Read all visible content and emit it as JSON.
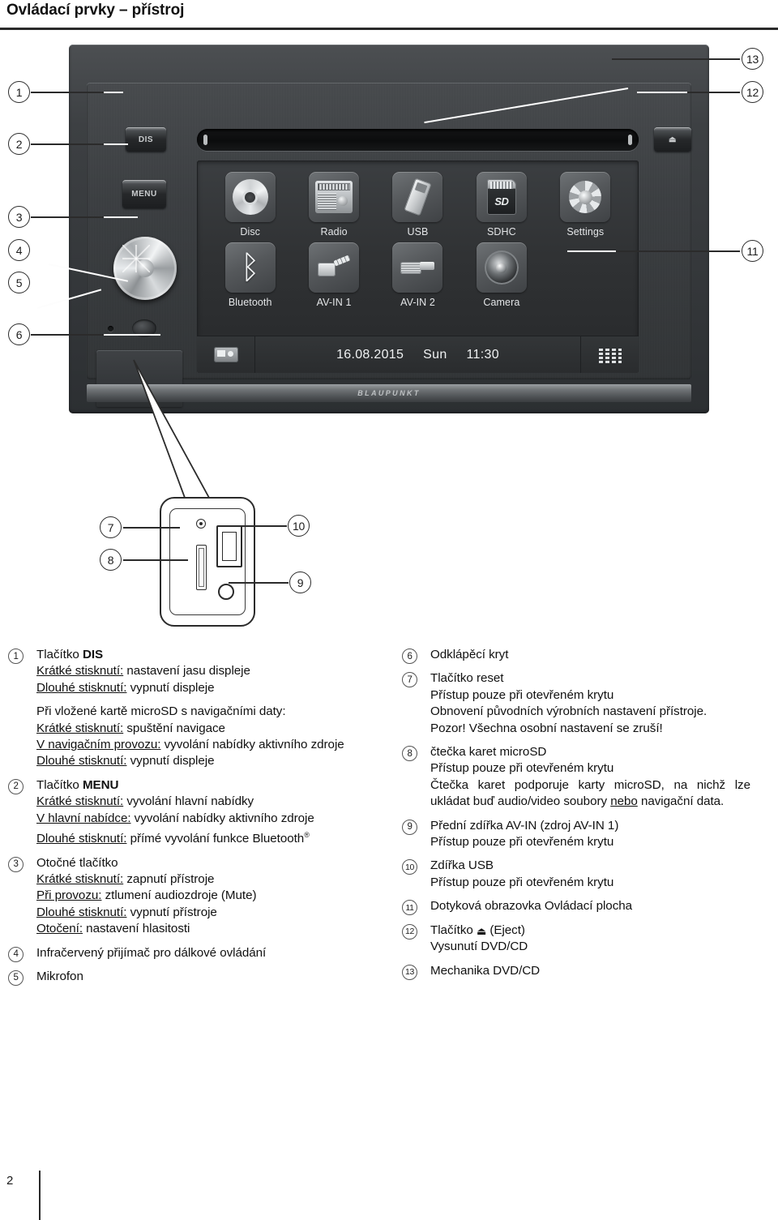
{
  "header": {
    "title": "Ovládací prvky – přístroj"
  },
  "device": {
    "brand": "BLAUPUNKT",
    "buttons": {
      "dis": "DIS",
      "menu": "MENU",
      "eject": "⏏"
    },
    "screen": {
      "apps": [
        {
          "label": "Disc",
          "icon": "disc-icon"
        },
        {
          "label": "Radio",
          "icon": "radio-icon"
        },
        {
          "label": "USB",
          "icon": "usb-icon"
        },
        {
          "label": "SDHC",
          "icon": "sd-card-icon"
        },
        {
          "label": "Settings",
          "icon": "gear-icon"
        },
        {
          "label": "Bluetooth",
          "icon": "bluetooth-icon"
        },
        {
          "label": "AV-IN 1",
          "icon": "av-jack-angled-icon"
        },
        {
          "label": "AV-IN 2",
          "icon": "av-jack-straight-icon"
        },
        {
          "label": "Camera",
          "icon": "camera-icon"
        }
      ],
      "sd_label": "SD",
      "bluetooth_glyph": "ᛒ",
      "status": {
        "date": "16.08.2015",
        "day": "Sun",
        "time": "11:30"
      }
    }
  },
  "callouts": [
    {
      "n": "1"
    },
    {
      "n": "2"
    },
    {
      "n": "3"
    },
    {
      "n": "4"
    },
    {
      "n": "5"
    },
    {
      "n": "6"
    },
    {
      "n": "7"
    },
    {
      "n": "8"
    },
    {
      "n": "9"
    },
    {
      "n": "10"
    },
    {
      "n": "11"
    },
    {
      "n": "12"
    },
    {
      "n": "13"
    }
  ],
  "legend": {
    "left": [
      {
        "n": "1",
        "lines": [
          {
            "t": "Tlačítko ",
            "b": "DIS"
          },
          {
            "u": "Krátké stisknutí:",
            "t": " nastavení jasu displeje"
          },
          {
            "u": "Dlouhé stisknutí:",
            "t": " vypnutí displeje"
          },
          {
            "gap": true
          },
          {
            "t": "Při vložené kartě microSD s navigačními daty:"
          },
          {
            "u": "Krátké stisknutí:",
            "t": " spuštění navigace"
          },
          {
            "u": "V navigačním provozu:",
            "t": " vyvolání nabídky aktivního zdroje",
            "just": true
          },
          {
            "u": "Dlouhé stisknutí:",
            "t": " vypnutí displeje"
          }
        ]
      },
      {
        "n": "2",
        "lines": [
          {
            "t": "Tlačítko ",
            "b": "MENU"
          },
          {
            "u": "Krátké stisknutí:",
            "t": " vyvolání hlavní nabídky"
          },
          {
            "u": "V hlavní nabídce:",
            "t": " vyvolání nabídky aktivního zdroje"
          },
          {
            "u": "Dlouhé stisknutí:",
            "t": " přímé vyvolání funkce Bluetooth",
            "reg": true
          }
        ]
      },
      {
        "n": "3",
        "lines": [
          {
            "t": "Otočné tlačítko"
          },
          {
            "u": "Krátké stisknutí:",
            "t": " zapnutí přístroje"
          },
          {
            "u": "Při provozu:",
            "t": " ztlumení audiozdroje (Mute)"
          },
          {
            "u": "Dlouhé stisknutí:",
            "t": " vypnutí přístroje"
          },
          {
            "u": "Otočení:",
            "t": " nastavení hlasitosti"
          }
        ]
      },
      {
        "n": "4",
        "lines": [
          {
            "t": "Infračervený přijímač pro dálkové ovládání"
          }
        ]
      },
      {
        "n": "5",
        "lines": [
          {
            "t": "Mikrofon"
          }
        ]
      }
    ],
    "right": [
      {
        "n": "6",
        "lines": [
          {
            "t": "Odklápěcí kryt"
          }
        ]
      },
      {
        "n": "7",
        "lines": [
          {
            "t": "Tlačítko reset"
          },
          {
            "t": "Přístup pouze při otevřeném krytu"
          },
          {
            "t": "Obnovení původních výrobních nastavení přístroje."
          },
          {
            "t": "Pozor! Všechna osobní nastavení se zruší!"
          }
        ]
      },
      {
        "n": "8",
        "lines": [
          {
            "t": "čtečka karet microSD"
          },
          {
            "t": "Přístup pouze při otevřeném krytu"
          },
          {
            "t": "Čtečka karet podporuje karty microSD, na nichž lze ukládat buď audio/video soubory ",
            "u2": "nebo",
            "t2": " navigační data.",
            "just": true
          }
        ]
      },
      {
        "n": "9",
        "lines": [
          {
            "t": "Přední zdířka AV-IN (zdroj AV-IN 1)"
          },
          {
            "t": "Přístup pouze při otevřeném krytu"
          }
        ]
      },
      {
        "n": "10",
        "lines": [
          {
            "t": "Zdířka USB"
          },
          {
            "t": "Přístup pouze při otevřeném krytu"
          }
        ]
      },
      {
        "n": "11",
        "lines": [
          {
            "t": "Dotyková obrazovka Ovládací plocha"
          }
        ]
      },
      {
        "n": "12",
        "lines": [
          {
            "t": "Tlačítko ",
            "eject": "⏏",
            "t2": " (Eject)"
          },
          {
            "t": "Vysunutí DVD/CD"
          }
        ]
      },
      {
        "n": "13",
        "lines": [
          {
            "t": "Mechanika DVD/CD"
          }
        ]
      }
    ]
  },
  "footer": {
    "page": "2"
  }
}
